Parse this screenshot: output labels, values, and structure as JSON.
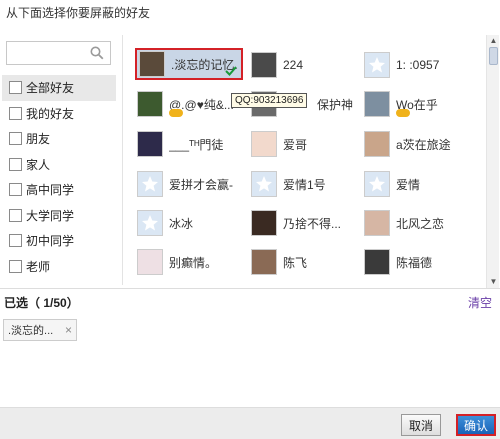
{
  "title": "从下面选择你要屏蔽的好友",
  "search": {
    "placeholder": ""
  },
  "groups": [
    "全部好友",
    "我的好友",
    "朋友",
    "家人",
    "高中同学",
    "大学同学",
    "初中同学",
    "老师"
  ],
  "friends": [
    {
      "name": ".淡忘的记忆.",
      "selected": true
    },
    {
      "name": "224"
    },
    {
      "name": "1:  :0957",
      "avatar": "placeholder"
    },
    {
      "name": "@.@♥纯&...",
      "vip": true
    },
    {
      "name": "保护神"
    },
    {
      "name": "Wo在乎",
      "vip": true
    },
    {
      "name": "___ᵀᴴ門徒"
    },
    {
      "name": "爱哥"
    },
    {
      "name": "a茨在旅途"
    },
    {
      "name": "爱拼才会赢-",
      "avatar": "placeholder"
    },
    {
      "name": "爱情1号",
      "avatar": "placeholder"
    },
    {
      "name": "爱情",
      "avatar": "placeholder"
    },
    {
      "name": "冰冰",
      "avatar": "placeholder"
    },
    {
      "name": "乃捨不得..."
    },
    {
      "name": "北风之恋"
    },
    {
      "name": "别癫情。"
    },
    {
      "name": "陈飞"
    },
    {
      "name": "陈福德"
    }
  ],
  "tooltip": "QQ:903213696",
  "selection": {
    "label": "已选（ 1/50）",
    "clear": "清空",
    "chip": ".淡忘的...",
    "chip_close": "×"
  },
  "buttons": {
    "cancel": "取消",
    "confirm": "确认"
  },
  "colors": {
    "highlight": "#d42127",
    "confirm": "#1a63b8",
    "link": "#6a3fa8"
  }
}
